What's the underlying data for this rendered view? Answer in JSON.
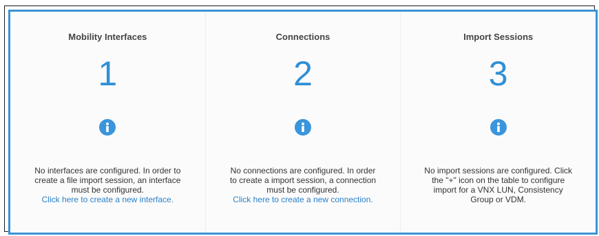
{
  "cards": [
    {
      "title": "Mobility Interfaces",
      "count": "1",
      "message": "No interfaces are configured. In order to create a file import session, an interface must be configured.",
      "link": "Click here to create a new interface."
    },
    {
      "title": "Connections",
      "count": "2",
      "message": "No connections are configured. In order to create a import session, a connection must be configured.",
      "link": "Click here to create a new connection."
    },
    {
      "title": "Import Sessions",
      "count": "3",
      "message": "No import sessions are configured. Click the \"+\" icon on the table to configure import for a VNX LUN, Consistency Group or VDM.",
      "link": ""
    }
  ],
  "colors": {
    "accent": "#3a93d6",
    "count": "#2f8fd6",
    "link": "#2a80c9"
  },
  "icons": {
    "info": "info-icon"
  }
}
